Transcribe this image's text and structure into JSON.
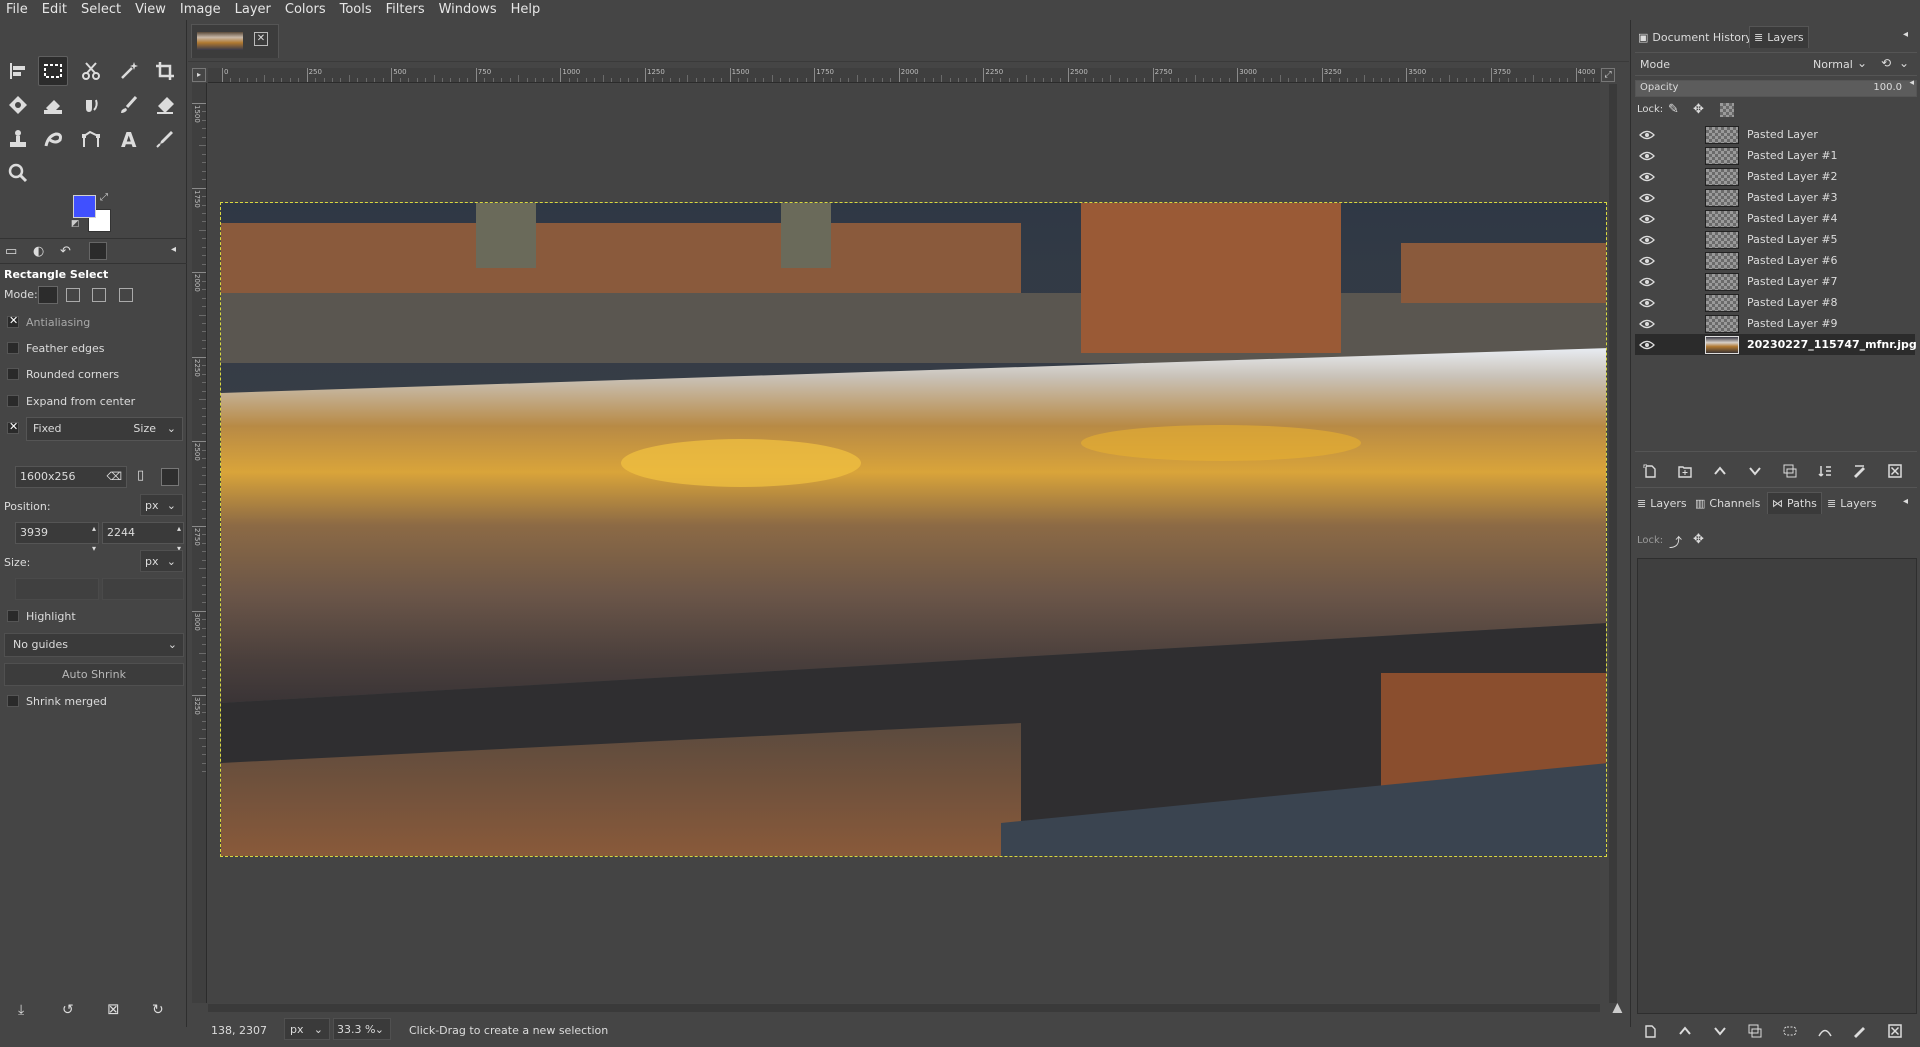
{
  "menu": [
    "File",
    "Edit",
    "Select",
    "View",
    "Image",
    "Layer",
    "Colors",
    "Tools",
    "Filters",
    "Windows",
    "Help"
  ],
  "toolbox": {
    "tools": [
      "align-icon",
      "rect-select-icon",
      "scissors-select-icon",
      "fuzzy-select-icon",
      "crop-icon",
      "warp-transform-icon",
      "bucket-fill-icon",
      "paint-dynamics-icon",
      "paintbrush-icon",
      "eraser-icon",
      "clone-icon",
      "smudge-icon",
      "paths-icon",
      "text-icon",
      "color-picker-icon",
      "zoom-icon"
    ],
    "colors": {
      "foreground": "#4050ff",
      "background": "#ffffff"
    }
  },
  "tool_options": {
    "title": "Rectangle Select",
    "mode_label": "Mode:",
    "antialiasing": {
      "label": "Antialiasing",
      "checked": true
    },
    "feather_edges": {
      "label": "Feather edges",
      "checked": false
    },
    "rounded_corners": {
      "label": "Rounded corners",
      "checked": false
    },
    "expand_from_center": {
      "label": "Expand from center",
      "checked": false
    },
    "fixed": {
      "label": "Fixed",
      "checked": true,
      "option": "Size"
    },
    "fixed_value": "1600x256",
    "position_label": "Position:",
    "position_unit": "px",
    "position_x": "3939",
    "position_y": "2244",
    "size_label": "Size:",
    "size_unit": "px",
    "highlight": {
      "label": "Highlight",
      "checked": false
    },
    "guides": "No guides",
    "auto_shrink": "Auto Shrink",
    "shrink_merged": {
      "label": "Shrink merged",
      "checked": false
    }
  },
  "ruler": {
    "h_ticks": [
      "0",
      "250",
      "500",
      "750",
      "1000",
      "1250",
      "1500",
      "1750",
      "2000",
      "2250",
      "2500",
      "2750",
      "3000",
      "3250",
      "3500",
      "3750",
      "4000"
    ],
    "v_ticks": [
      "1500",
      "1750",
      "2000",
      "2250",
      "2500",
      "2750",
      "3000",
      "3250"
    ]
  },
  "status": {
    "coords": "138, 2307",
    "unit": "px",
    "zoom": "33.3 %",
    "message": "Click-Drag to create a new selection"
  },
  "right_panel": {
    "top_tabs": [
      "Document History",
      "Layers"
    ],
    "mode_label": "Mode",
    "mode_value": "Normal",
    "opacity_label": "Opacity",
    "opacity_value": "100.0",
    "opacity_fraction": 1.0,
    "lock_label": "Lock:",
    "layers": [
      "Pasted Layer",
      "Pasted Layer #1",
      "Pasted Layer #2",
      "Pasted Layer #3",
      "Pasted Layer #4",
      "Pasted Layer #5",
      "Pasted Layer #6",
      "Pasted Layer #7",
      "Pasted Layer #8",
      "Pasted Layer #9",
      "20230227_115747_mfnr.jpg"
    ],
    "bottom_tabs": [
      "Layers",
      "Channels",
      "Paths",
      "Layers"
    ],
    "bottom_lock_label": "Lock:"
  }
}
